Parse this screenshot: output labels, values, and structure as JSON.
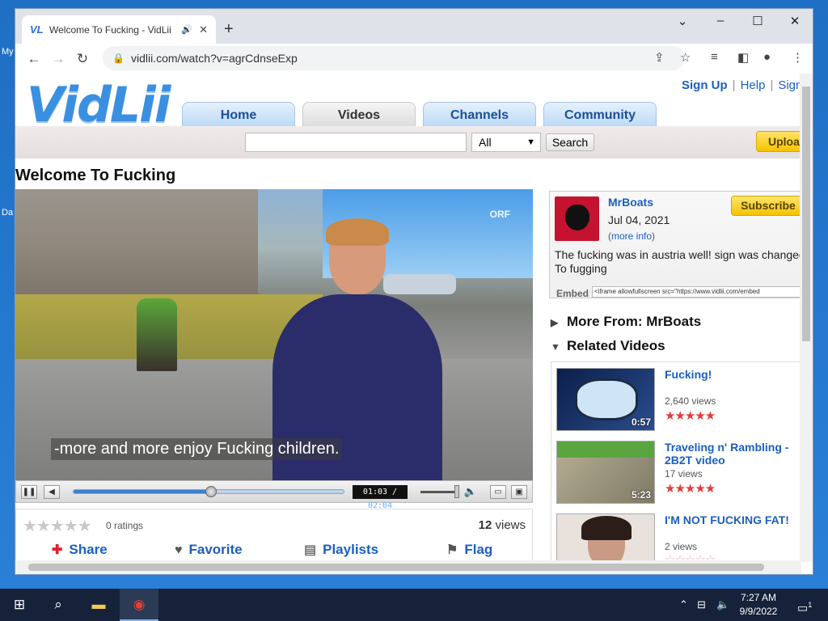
{
  "desktop": {
    "label1": "My",
    "label2": "Da"
  },
  "browser": {
    "tab_title": "Welcome To Fucking - VidLii",
    "tab_favicon": "VL",
    "url": "vidlii.com/watch?v=agrCdnseExp"
  },
  "site": {
    "logo": "VidLii",
    "sign_up": "Sign Up",
    "help": "Help",
    "sign_in": "Sign",
    "nav": [
      "Home",
      "Videos",
      "Channels",
      "Community"
    ],
    "search_placeholder": "",
    "search_scope": "All",
    "search_button": "Search",
    "upload_button": "Upload"
  },
  "video": {
    "title": "Welcome To Fucking",
    "watermark": "ORF",
    "subtitle": "-more and more enjoy Fucking children.",
    "current_time": "01:03",
    "duration": "02:04",
    "progress_fraction": 0.508,
    "ratings_text": "0 ratings",
    "views_count": "12",
    "views_label": "views",
    "actions": {
      "share": "Share",
      "favorite": "Favorite",
      "playlists": "Playlists",
      "flag": "Flag"
    }
  },
  "uploader": {
    "name": "MrBoats",
    "date": "Jul 04, 2021",
    "more_open": "(",
    "more_info": "more info",
    "more_close": ")",
    "subscribe": "Subscribe",
    "description_line1": "The fucking was in austria well! sign was changed",
    "description_line2": "To fugging",
    "embed_label": "Embed",
    "embed_code": "<iframe allowfullscreen src=\"https://www.vidlii.com/embed"
  },
  "sections": {
    "more_from": "More From: MrBoats",
    "related": "Related Videos"
  },
  "related": [
    {
      "title": "Fucking!",
      "views": "2,640 views",
      "duration": "0:57",
      "rating": 5
    },
    {
      "title": "Traveling n' Rambling - 2B2T video",
      "views": "17 views",
      "duration": "5:23",
      "rating": 5
    },
    {
      "title": "I'M NOT FUCKING FAT!",
      "views": "2 views",
      "duration": "",
      "rating": 0
    }
  ],
  "taskbar": {
    "time": "7:27 AM",
    "date": "9/9/2022",
    "notifications": "1"
  }
}
